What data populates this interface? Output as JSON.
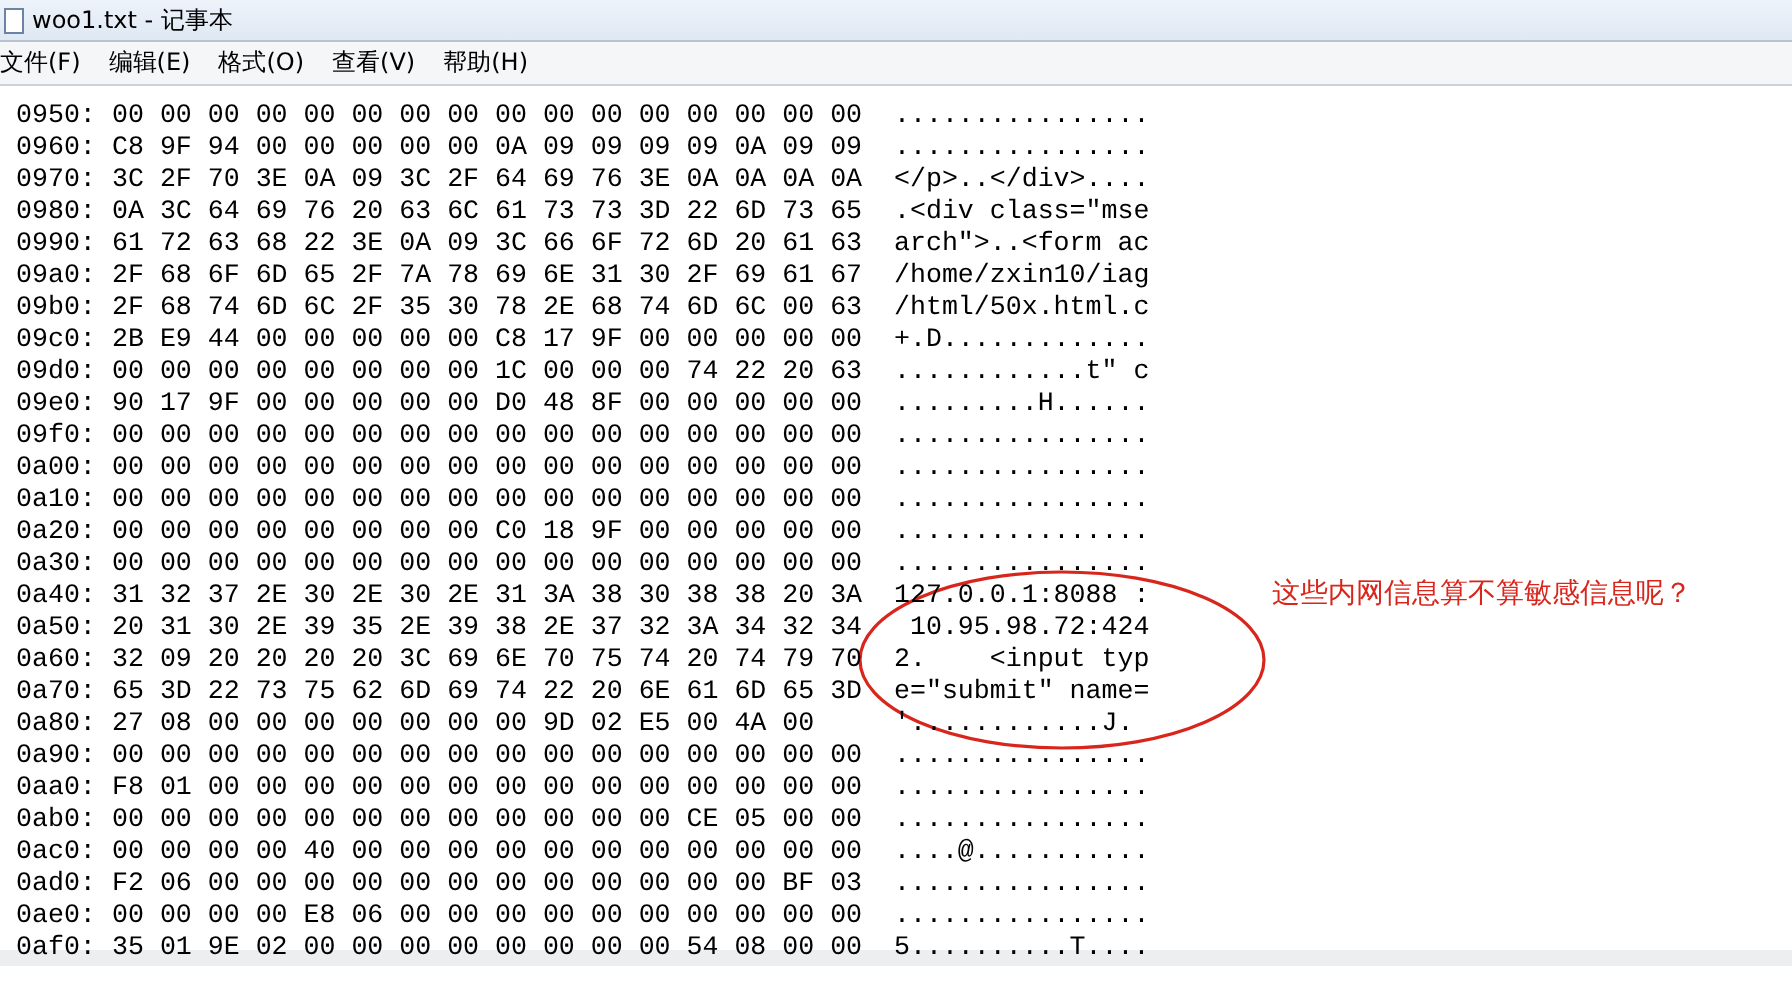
{
  "window": {
    "title": "woo1.txt - 记事本"
  },
  "menu": [
    {
      "label": "文件(F)"
    },
    {
      "label": "编辑(E)"
    },
    {
      "label": "格式(O)"
    },
    {
      "label": "查看(V)"
    },
    {
      "label": "帮助(H)"
    }
  ],
  "rows": [
    {
      "offset": "0950:",
      "hex": "00 00 00 00 00 00 00 00 00 00 00 00 00 00 00 00",
      "ascii": "................"
    },
    {
      "offset": "0960:",
      "hex": "C8 9F 94 00 00 00 00 00 0A 09 09 09 09 0A 09 09",
      "ascii": "................"
    },
    {
      "offset": "0970:",
      "hex": "3C 2F 70 3E 0A 09 3C 2F 64 69 76 3E 0A 0A 0A 0A",
      "ascii": "</p>..</div>...."
    },
    {
      "offset": "0980:",
      "hex": "0A 3C 64 69 76 20 63 6C 61 73 73 3D 22 6D 73 65",
      "ascii": ".<div class=\"mse"
    },
    {
      "offset": "0990:",
      "hex": "61 72 63 68 22 3E 0A 09 3C 66 6F 72 6D 20 61 63",
      "ascii": "arch\">..<form ac"
    },
    {
      "offset": "09a0:",
      "hex": "2F 68 6F 6D 65 2F 7A 78 69 6E 31 30 2F 69 61 67",
      "ascii": "/home/zxin10/iag"
    },
    {
      "offset": "09b0:",
      "hex": "2F 68 74 6D 6C 2F 35 30 78 2E 68 74 6D 6C 00 63",
      "ascii": "/html/50x.html.c"
    },
    {
      "offset": "09c0:",
      "hex": "2B E9 44 00 00 00 00 00 C8 17 9F 00 00 00 00 00",
      "ascii": "+.D............."
    },
    {
      "offset": "09d0:",
      "hex": "00 00 00 00 00 00 00 00 1C 00 00 00 74 22 20 63",
      "ascii": "............t\" c"
    },
    {
      "offset": "09e0:",
      "hex": "90 17 9F 00 00 00 00 00 D0 48 8F 00 00 00 00 00",
      "ascii": ".........H......"
    },
    {
      "offset": "09f0:",
      "hex": "00 00 00 00 00 00 00 00 00 00 00 00 00 00 00 00",
      "ascii": "................"
    },
    {
      "offset": "0a00:",
      "hex": "00 00 00 00 00 00 00 00 00 00 00 00 00 00 00 00",
      "ascii": "................"
    },
    {
      "offset": "0a10:",
      "hex": "00 00 00 00 00 00 00 00 00 00 00 00 00 00 00 00",
      "ascii": "................"
    },
    {
      "offset": "0a20:",
      "hex": "00 00 00 00 00 00 00 00 C0 18 9F 00 00 00 00 00",
      "ascii": "................"
    },
    {
      "offset": "0a30:",
      "hex": "00 00 00 00 00 00 00 00 00 00 00 00 00 00 00 00",
      "ascii": "................"
    },
    {
      "offset": "0a40:",
      "hex": "31 32 37 2E 30 2E 30 2E 31 3A 38 30 38 38 20 3A",
      "ascii": "127.0.0.1:8088 :"
    },
    {
      "offset": "0a50:",
      "hex": "20 31 30 2E 39 35 2E 39 38 2E 37 32 3A 34 32 34",
      "ascii": " 10.95.98.72:424"
    },
    {
      "offset": "0a60:",
      "hex": "32 09 20 20 20 20 3C 69 6E 70 75 74 20 74 79 70",
      "ascii": "2.    <input typ"
    },
    {
      "offset": "0a70:",
      "hex": "65 3D 22 73 75 62 6D 69 74 22 20 6E 61 6D 65 3D",
      "ascii": "e=\"submit\" name="
    },
    {
      "offset": "0a80:",
      "hex": "27 08 00 00 00 00 00 00 00 9D 02 E5 00 4A 00",
      "ascii": "'............J."
    },
    {
      "offset": "0a90:",
      "hex": "00 00 00 00 00 00 00 00 00 00 00 00 00 00 00 00",
      "ascii": "................"
    },
    {
      "offset": "0aa0:",
      "hex": "F8 01 00 00 00 00 00 00 00 00 00 00 00 00 00 00",
      "ascii": "................"
    },
    {
      "offset": "0ab0:",
      "hex": "00 00 00 00 00 00 00 00 00 00 00 00 CE 05 00 00",
      "ascii": "................"
    },
    {
      "offset": "0ac0:",
      "hex": "00 00 00 00 40 00 00 00 00 00 00 00 00 00 00 00",
      "ascii": "....@..........."
    },
    {
      "offset": "0ad0:",
      "hex": "F2 06 00 00 00 00 00 00 00 00 00 00 00 00 BF 03",
      "ascii": "................"
    },
    {
      "offset": "0ae0:",
      "hex": "00 00 00 00 E8 06 00 00 00 00 00 00 00 00 00 00",
      "ascii": "................"
    },
    {
      "offset": "0af0:",
      "hex": "35 01 9E 02 00 00 00 00 00 00 00 00 54 08 00 00",
      "ascii": "5..........T...."
    }
  ],
  "annotation": {
    "text": "这些内网信息算不算敏感信息呢？"
  }
}
